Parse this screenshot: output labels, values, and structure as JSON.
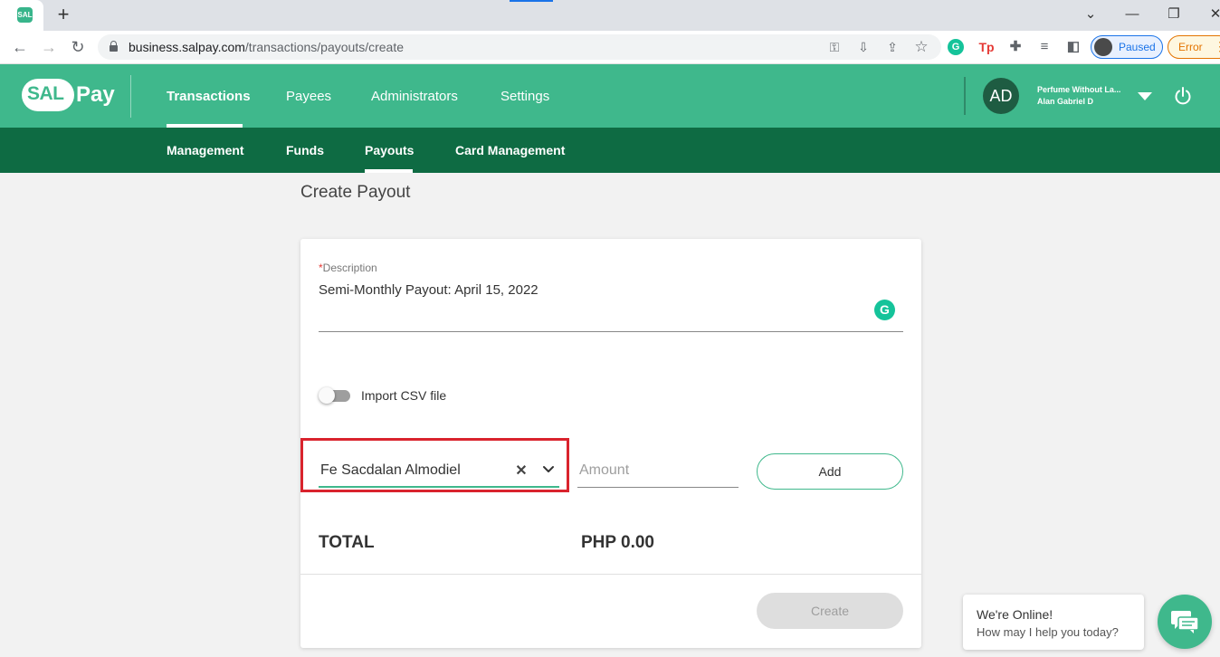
{
  "browser": {
    "tab_favicon_text": "SAL",
    "new_tab": "+",
    "window_controls": [
      "⌄",
      "—",
      "❐",
      "✕"
    ],
    "url_host": "business.salpay.com",
    "url_path": "/transactions/payouts/create",
    "profile_status": "Paused",
    "error_label": "Error",
    "error_menu": "⋮",
    "icons": [
      "back-icon",
      "forward-icon",
      "reload-icon",
      "lock-icon",
      "key-icon",
      "install-icon",
      "share-icon",
      "star-icon",
      "grammarly-ext-icon",
      "tp-ext-icon",
      "puzzle-icon",
      "media-icon",
      "sidepanel-icon"
    ]
  },
  "header": {
    "logo_sal": "SAL",
    "logo_pay": "Pay",
    "nav": [
      "Transactions",
      "Payees",
      "Administrators",
      "Settings"
    ],
    "active_nav": "Transactions",
    "user_initials": "AD",
    "user_company": "Perfume Without La...",
    "user_name": "Alan Gabriel D"
  },
  "subnav": {
    "items": [
      "Management",
      "Funds",
      "Payouts",
      "Card Management"
    ],
    "active": "Payouts"
  },
  "page": {
    "title": "Create Payout"
  },
  "form": {
    "description_required_mark": "*",
    "description_label": "Description",
    "description_value": "Semi-Monthly Payout: April 15, 2022",
    "grammarly_glyph": "G",
    "import_csv_label": "Import CSV file",
    "import_csv_enabled": false,
    "payee_value": "Fe Sacdalan Almodiel",
    "clear_glyph": "✕",
    "amount_placeholder": "Amount",
    "add_label": "Add",
    "total_label": "TOTAL",
    "total_amount": "PHP 0.00",
    "create_label": "Create"
  },
  "chat": {
    "title": "We're Online!",
    "subtitle": "How may I help you today?"
  },
  "colors": {
    "brand": "#3fb88c",
    "brand_dark": "#0e6b43",
    "highlight": "#d9232d"
  }
}
